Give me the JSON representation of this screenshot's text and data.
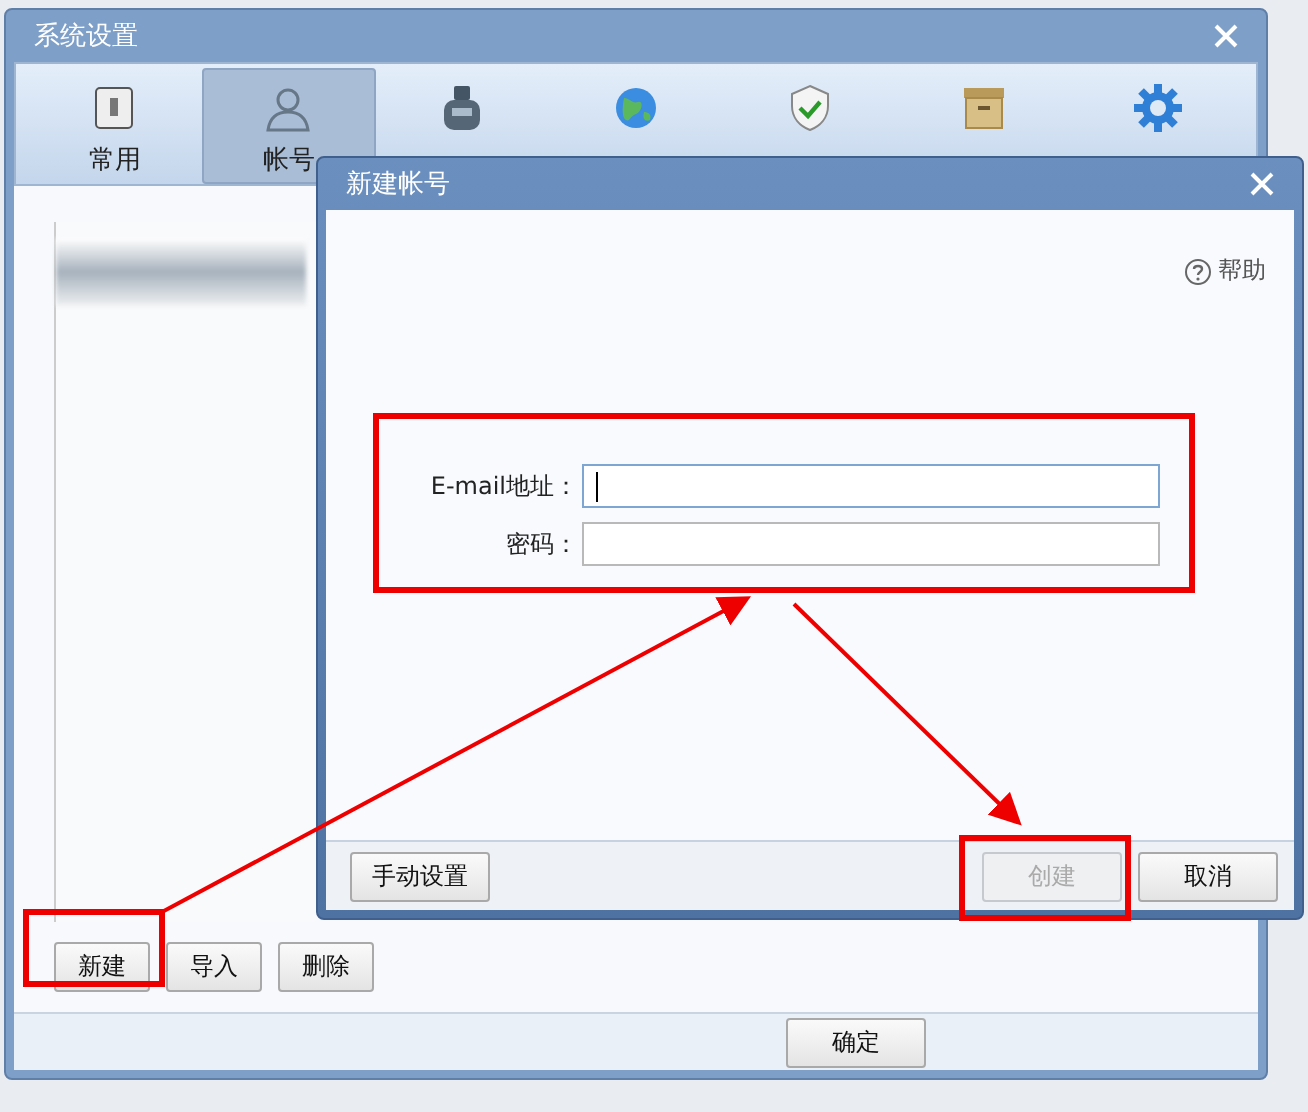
{
  "window": {
    "title": "系统设置"
  },
  "tabs": [
    {
      "label": "常用",
      "selected": false
    },
    {
      "label": "帐号",
      "selected": true
    },
    {
      "selected": false
    },
    {
      "selected": false
    },
    {
      "selected": false
    },
    {
      "selected": false
    },
    {
      "selected": false
    }
  ],
  "account_buttons": [
    "新建",
    "导入",
    "删除"
  ],
  "footer_buttons": [
    "确定"
  ],
  "dialog": {
    "title": "新建帐号",
    "help": "帮助",
    "fields": [
      {
        "label": "E-mail地址：",
        "focused": true
      },
      {
        "label": "密码：",
        "focused": false
      }
    ],
    "buttons": [
      {
        "label": "手动设置",
        "disabled": false
      },
      {
        "label": "创建",
        "disabled": true
      },
      {
        "label": "取消",
        "disabled": false
      }
    ]
  }
}
